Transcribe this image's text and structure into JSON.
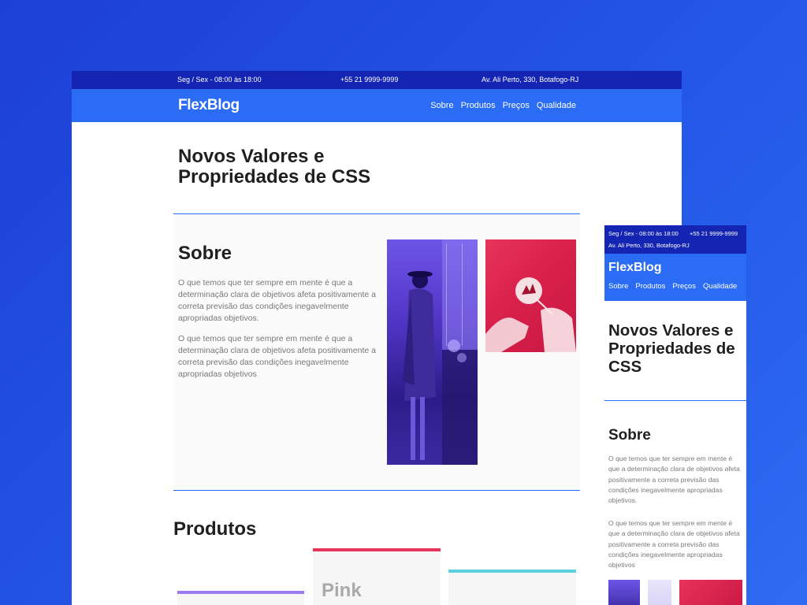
{
  "topbar": {
    "hours": "Seg / Sex - 08:00 às 18:00",
    "phone": "+55 21 9999-9999",
    "address": "Av. Ali Perto, 330, Botafogo-RJ"
  },
  "header": {
    "logo": "FlexBlog",
    "menu": [
      "Sobre",
      "Produtos",
      "Preços",
      "Qualidade"
    ]
  },
  "hero": {
    "title": "Novos Valores e Propriedades de CSS"
  },
  "about": {
    "title": "Sobre",
    "paragraphs": [
      "O que temos que ter sempre em mente é que a determinação clara de objetivos afeta positivamente a correta previsão das condições inegavelmente apropriadas objetivos.",
      "O que temos que ter sempre em mente é que a determinação clara de objetivos afeta positivamente a correta previsão das condições inegavelmente apropriadas objetivos"
    ]
  },
  "products": {
    "title": "Produtos",
    "cards": [
      {
        "label": "",
        "color": "#9b7cf0"
      },
      {
        "label": "Pink",
        "color": "#e8335a"
      },
      {
        "label": "",
        "color": "#5bd0e0"
      }
    ]
  },
  "colors": {
    "background": "#2457e8",
    "topbar": "#1425b3",
    "nav": "#2b6cf5",
    "accent_pink": "#e8335a",
    "accent_purple": "#6d55e8"
  }
}
